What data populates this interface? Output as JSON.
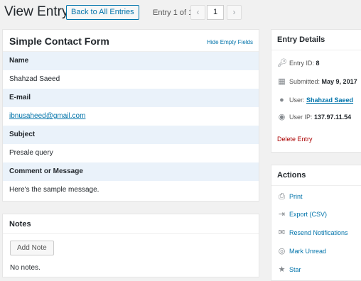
{
  "header": {
    "title": "View Entry",
    "back_button": "Back to All Entries",
    "pager_label": "Entry 1 of 1",
    "prev": "‹",
    "current_page": "1",
    "next": "›"
  },
  "form": {
    "title": "Simple Contact Form",
    "hide_empty": "Hide Empty Fields",
    "fields": [
      {
        "label": "Name",
        "value": "Shahzad Saeed"
      },
      {
        "label": "E-mail",
        "value": "ibnusaheed@gmail.com"
      },
      {
        "label": "Subject",
        "value": "Presale query"
      },
      {
        "label": "Comment or Message",
        "value": "Here's the sample message."
      }
    ]
  },
  "notes": {
    "title": "Notes",
    "add_button": "Add Note",
    "empty_text": "No notes."
  },
  "details": {
    "title": "Entry Details",
    "entry_id_label": "Entry ID:",
    "entry_id": "8",
    "submitted_label": "Submitted:",
    "submitted": "May 9, 2017",
    "user_label": "User:",
    "user": "Shahzad Saeed",
    "ip_label": "User IP:",
    "ip": "137.97.11.54",
    "delete": "Delete Entry"
  },
  "actions": {
    "title": "Actions",
    "items": [
      {
        "label": "Print",
        "icon": "print-icon"
      },
      {
        "label": "Export (CSV)",
        "icon": "export-icon"
      },
      {
        "label": "Resend Notifications",
        "icon": "email-icon"
      },
      {
        "label": "Mark Unread",
        "icon": "eye-slash-icon"
      },
      {
        "label": "Star",
        "icon": "star-icon"
      }
    ]
  }
}
